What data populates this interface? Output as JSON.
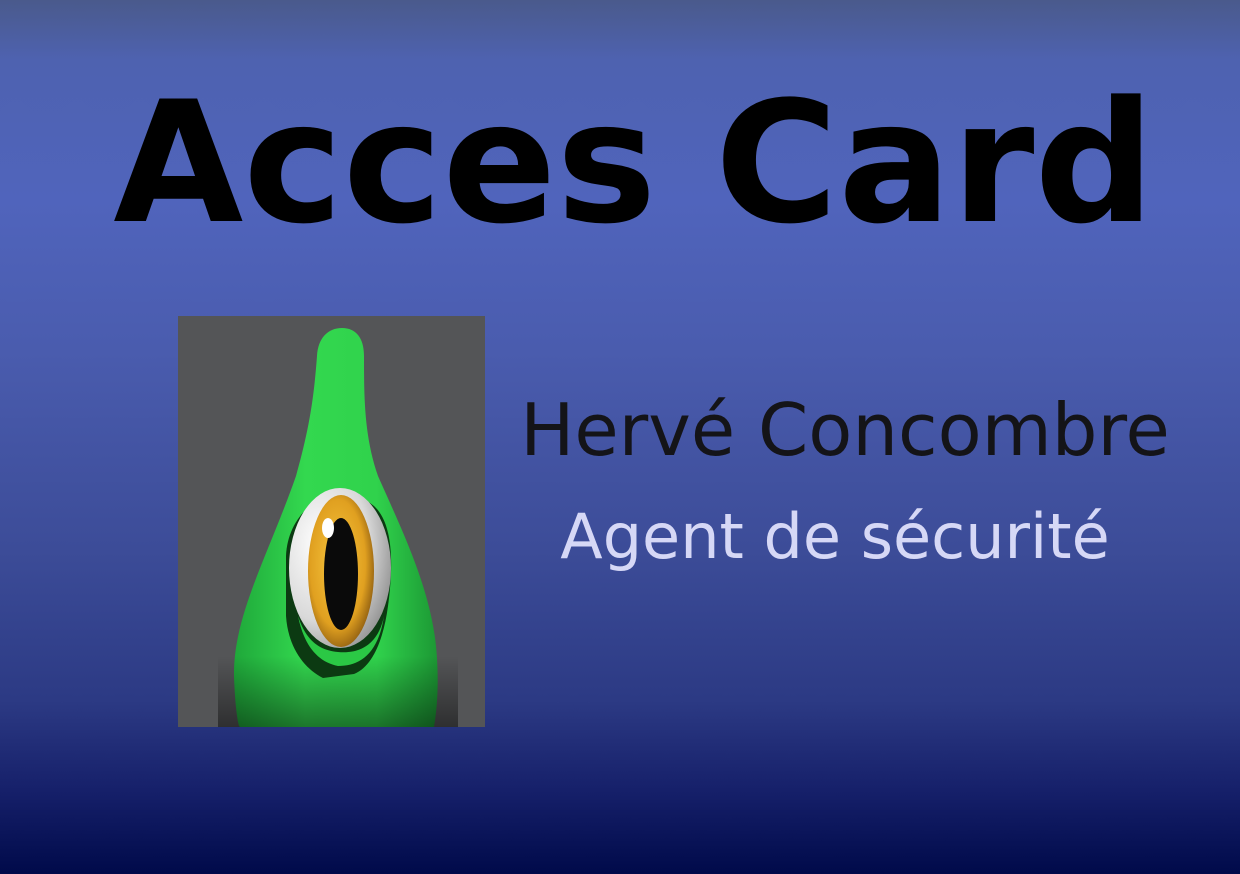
{
  "card": {
    "title": "Acces Card",
    "name": "Hervé Concombre",
    "role": "Agent de sécurité",
    "portrait_icon": "green-cucumber-cyclops-icon"
  },
  "colors": {
    "background_top": "#4e62b0",
    "background_bottom": "#000a4a",
    "title": "#000000",
    "name": "#141418",
    "role": "#d6d8f6",
    "portrait_bg": "#545557",
    "character_green": "#2fd44c",
    "iris": "#e0a020"
  }
}
